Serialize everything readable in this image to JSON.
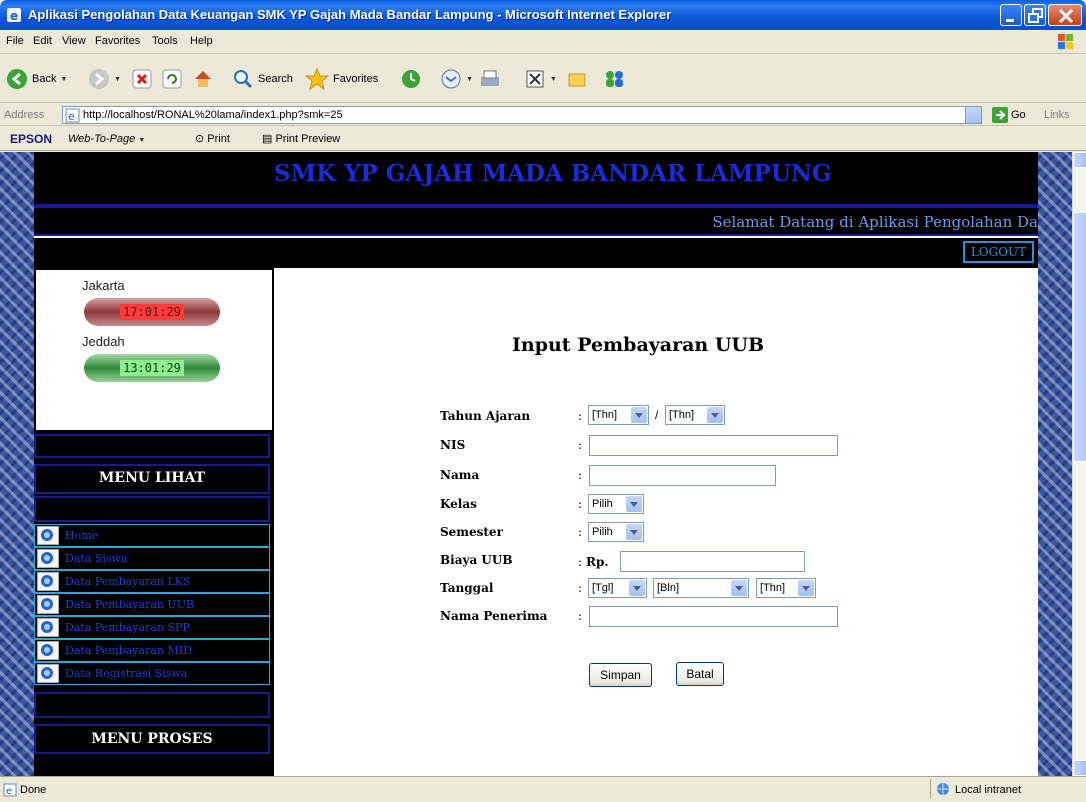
{
  "window": {
    "title": "Aplikasi Pengolahan Data Keuangan SMK YP Gajah Mada Bandar Lampung - Microsoft Internet Explorer"
  },
  "menubar": [
    "File",
    "Edit",
    "View",
    "Favorites",
    "Tools",
    "Help"
  ],
  "toolbar": {
    "back_label": "Back",
    "search_label": "Search",
    "favorites_label": "Favorites"
  },
  "address": {
    "label": "Address",
    "url": "http://localhost/RONAL%20lama/index1.php?smk=25",
    "go_label": "Go",
    "links_label": "Links"
  },
  "epson": {
    "brand": "EPSON",
    "web_to_page": "Web-To-Page",
    "print": "Print",
    "print_preview": "Print Preview"
  },
  "page": {
    "school_name": "SMK YP GAJAH MADA BANDAR LAMPUNG",
    "welcome": "Selamat Datang di Aplikasi Pengolahan Da",
    "logout": "LOGOUT",
    "clock": {
      "city1": "Jakarta",
      "time1": "17:01:29",
      "city2": "Jeddah",
      "time2": "13:01:29"
    },
    "menu_lihat_title": "MENU LIHAT",
    "menu_items": [
      "Home",
      "Data Siswa",
      "Data Pembayaran LKS",
      "Data Pembayaran UUB",
      "Data Pembayaran SPP",
      "Data Pembayaran MID",
      "Data Registrasi Siswa"
    ],
    "menu_proses_title": "MENU PROSES"
  },
  "form": {
    "title": "Input Pembayaran UUB",
    "labels": {
      "tahun_ajaran": "Tahun Ajaran",
      "nis": "NIS",
      "nama": "Nama",
      "kelas": "Kelas",
      "semester": "Semester",
      "biaya": "Biaya UUB",
      "tanggal": "Tanggal",
      "penerima": "Nama Penerima"
    },
    "colon": ":",
    "slash": "/",
    "currency": "Rp.",
    "selects": {
      "thn_from": "[Thn]",
      "thn_to": "[Thn]",
      "kelas": "Pilih",
      "semester": "Pilih",
      "tgl": "[Tgl]",
      "bln": "[Bln]",
      "thn": "[Thn]"
    },
    "buttons": {
      "save": "Simpan",
      "cancel": "Batal"
    }
  },
  "status": {
    "text": "Done",
    "zone": "Local intranet"
  }
}
